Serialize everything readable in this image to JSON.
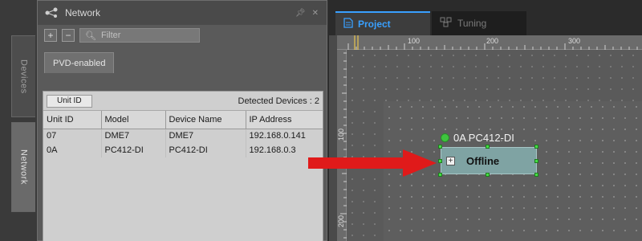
{
  "side_tabs": {
    "devices": "Devices",
    "network": "Network"
  },
  "network_panel": {
    "title": "Network",
    "filter_placeholder": "Filter",
    "subtab": "PVD-enabled",
    "unit_id_button": "Unit ID",
    "detected_devices": "Detected Devices : 2",
    "columns": [
      "Unit ID",
      "Model",
      "Device Name",
      "IP Address"
    ],
    "rows": [
      [
        "07",
        "DME7",
        "DME7",
        "192.168.0.141"
      ],
      [
        "0A",
        "PC412-DI",
        "PC412-DI",
        "192.168.0.3"
      ]
    ]
  },
  "doc_tabs": {
    "project": "Project",
    "tuning": "Tuning"
  },
  "rulers": {
    "top": [
      "100",
      "200",
      "300"
    ],
    "left": [
      "100",
      "200"
    ]
  },
  "device": {
    "label": "0A PC412-DI",
    "status": "Offline"
  },
  "colors": {
    "accent": "#39a0ff",
    "online": "#3ec43e",
    "arrow": "#e01a1a",
    "device_fill": "#7fa3a3"
  }
}
